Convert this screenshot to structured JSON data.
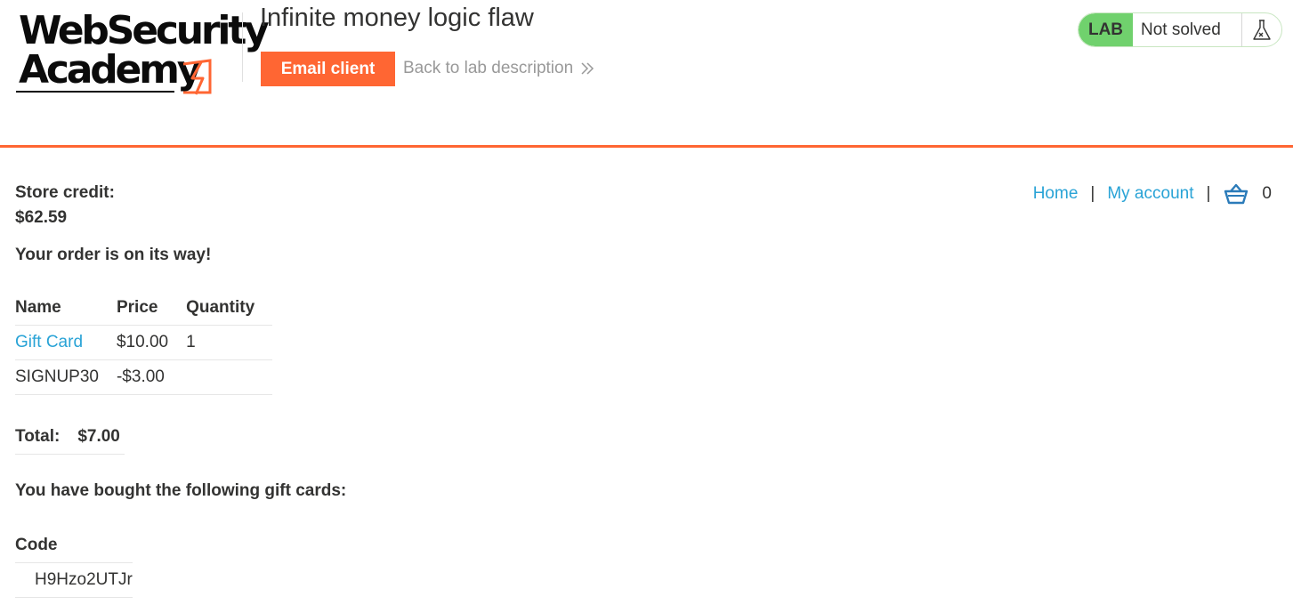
{
  "header": {
    "logo": {
      "line1": "WebSecurity",
      "line2": "Academy"
    },
    "lab_title": "Infinite money logic flaw",
    "email_client_label": "Email client",
    "back_link_label": "Back to lab description",
    "lab_badge": "LAB",
    "lab_status": "Not solved"
  },
  "nav": {
    "home": "Home",
    "separator": "|",
    "my_account": "My account",
    "cart_count": "0"
  },
  "account": {
    "store_credit_label": "Store credit:",
    "store_credit_value": "$62.59"
  },
  "order": {
    "message": "Your order is on its way!",
    "columns": [
      "Name",
      "Price",
      "Quantity"
    ],
    "rows": [
      {
        "name": "Gift Card",
        "price": "$10.00",
        "quantity": "1"
      },
      {
        "name": "SIGNUP30",
        "price": "-$3.00",
        "quantity": ""
      }
    ],
    "total_label": "Total:",
    "total_value": "$7.00"
  },
  "gift_cards": {
    "message": "You have bought the following gift cards:",
    "column": "Code",
    "codes": [
      "H9Hzo2UTJr"
    ]
  },
  "colors": {
    "accent_orange": "#ff6633",
    "link_blue": "#29a3d6",
    "lab_green": "#70d16d",
    "text": "#333332"
  },
  "icons": {
    "back": "double-chevron-right-icon",
    "flask": "flask-icon",
    "cart": "cart-icon",
    "logo_mark": "lightning-bolt-icon"
  }
}
